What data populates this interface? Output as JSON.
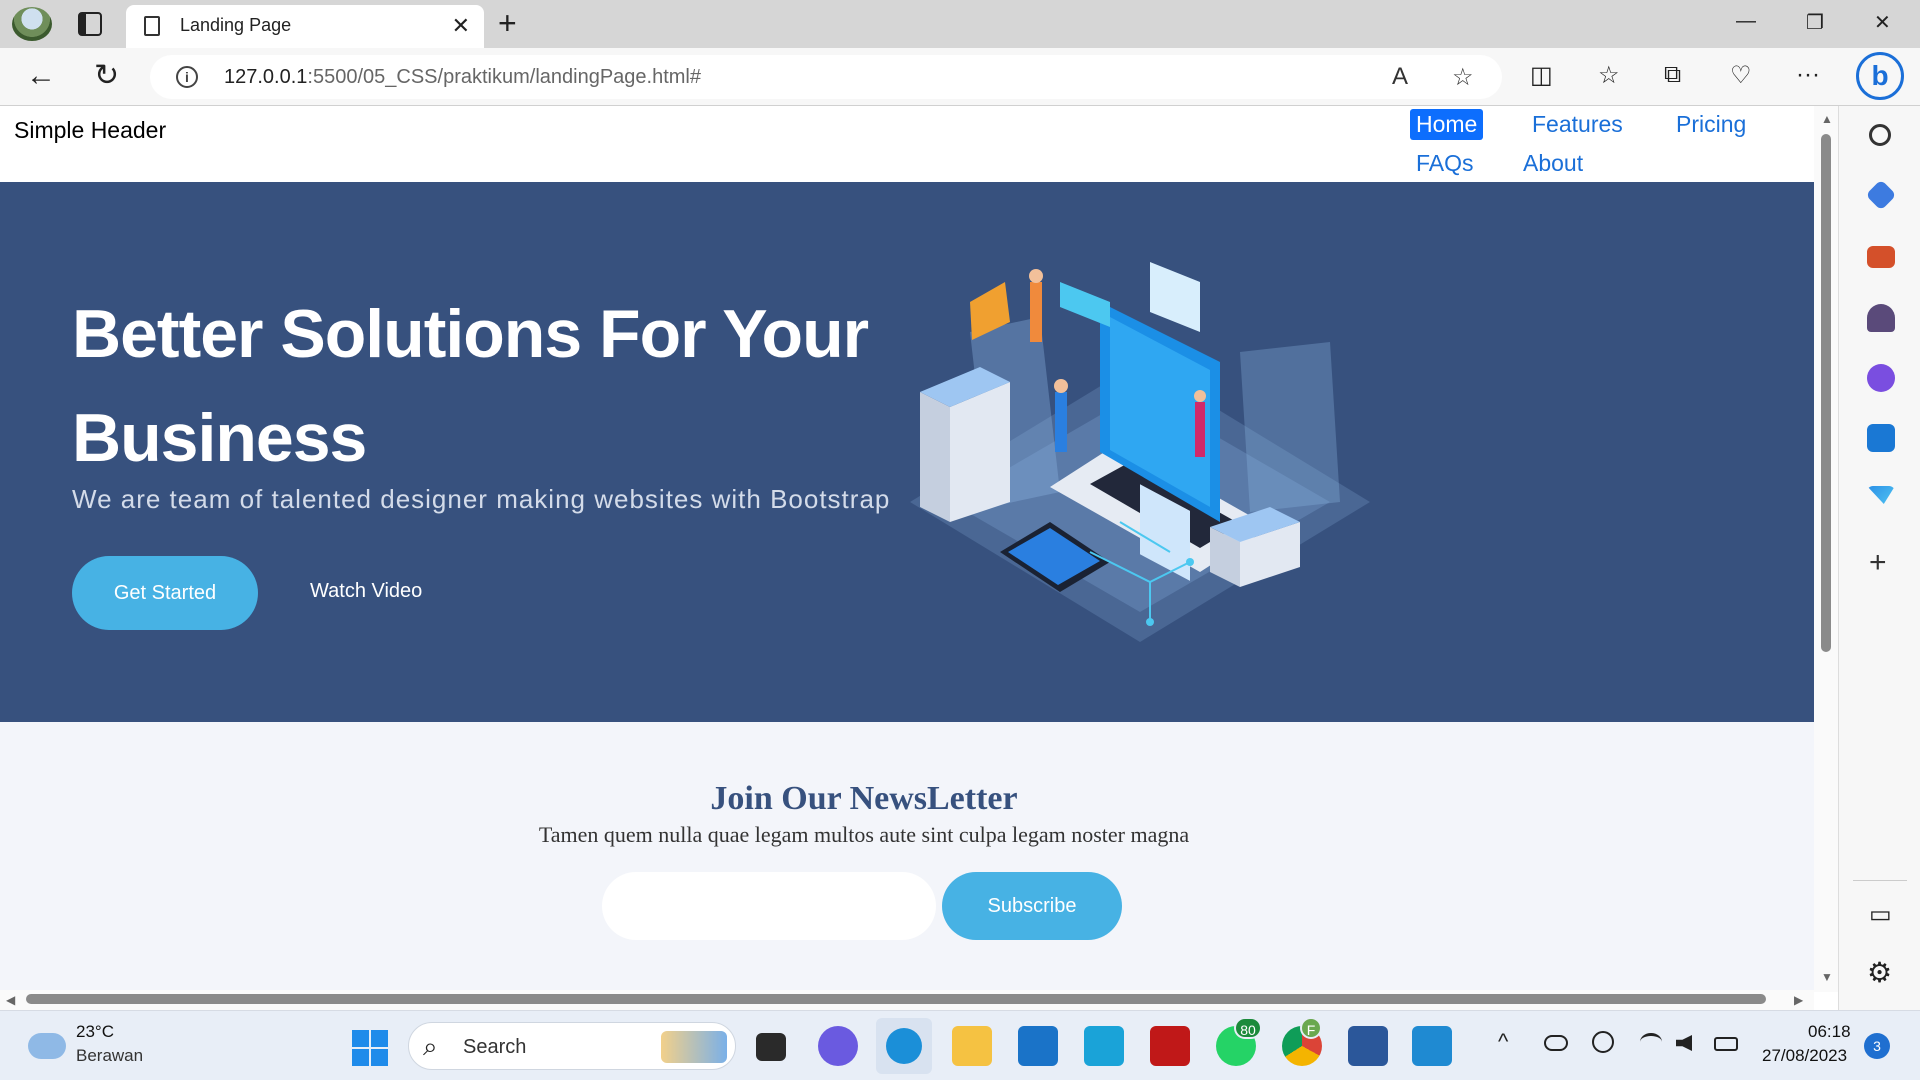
{
  "browser": {
    "tab_title": "Landing Page",
    "tab_close": "✕",
    "new_tab": "+",
    "url_host": "127.0.0.1",
    "url_path": ":5500/05_CSS/praktikum/landingPage.html#",
    "win_minimize": "—",
    "win_restore": "❐",
    "win_close": "✕",
    "back": "←",
    "refresh": "↻",
    "info": "i",
    "read_aloud": "A",
    "favorite": "☆",
    "split": "◫",
    "favorites": "☆",
    "collections": "⧉",
    "health": "♡",
    "more": "···",
    "bing": "b"
  },
  "sidebar": {
    "add": "+",
    "panel": "▭",
    "settings": "⚙"
  },
  "header": {
    "logo": "Simple Header",
    "nav": [
      "Home",
      "Features",
      "Pricing",
      "FAQs",
      "About"
    ]
  },
  "hero": {
    "title": "Better Solutions For Your Business",
    "subtitle": "We are team of talented designer making websites with Bootstrap",
    "btn_start": "Get Started",
    "btn_video": "Watch Video"
  },
  "newsletter": {
    "title": "Join Our NewsLetter",
    "text": "Tamen quem nulla quae legam multos aute sint culpa legam noster magna",
    "email_placeholder": "",
    "subscribe": "Subscribe"
  },
  "taskbar": {
    "temperature": "23°C",
    "weather": "Berawan",
    "search_icon": "⌕",
    "search": "Search",
    "whatsapp_badge": "80",
    "chrome_badge": "F",
    "tray_chevron": "^",
    "time": "06:18",
    "date": "27/08/2023",
    "notifications": "3",
    "colors": {
      "edge": "#1b8fd8",
      "whatsapp": "#25d366",
      "word": "#2b579a",
      "vscode": "#1f8ad2",
      "mcafee": "#c01818"
    }
  }
}
